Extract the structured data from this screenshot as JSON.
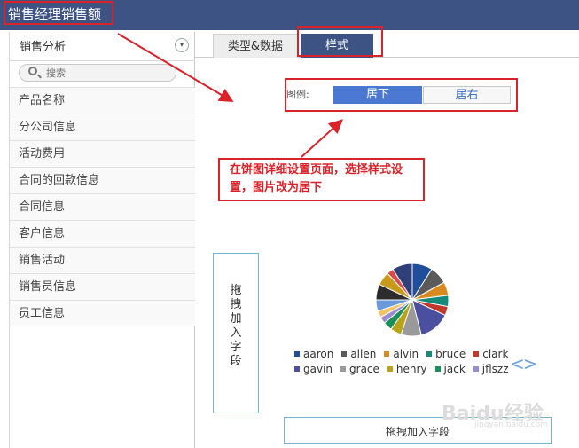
{
  "app": {
    "title": "销售经理销售额"
  },
  "sidebar": {
    "header": "销售分析",
    "search_placeholder": "搜索",
    "items": [
      {
        "label": "产品名称"
      },
      {
        "label": "分公司信息"
      },
      {
        "label": "活动费用"
      },
      {
        "label": "合同的回款信息"
      },
      {
        "label": "合同信息"
      },
      {
        "label": "客户信息"
      },
      {
        "label": "销售活动"
      },
      {
        "label": "销售员信息"
      },
      {
        "label": "员工信息"
      }
    ]
  },
  "tabs": {
    "type_data": "类型&数据",
    "style": "样式"
  },
  "legend_setting": {
    "label": "图例:",
    "options": [
      "居下",
      "居右"
    ],
    "selected": "居下"
  },
  "annotation": {
    "text": "在饼图详细设置页面，选择样式设置，图片改为居下"
  },
  "dropzones": {
    "vertical": "拖拽加入字段",
    "horizontal": "拖拽加入字段"
  },
  "pager": {
    "prev": "<",
    "next": ">"
  },
  "watermark": {
    "brand": "Baidu经验",
    "url": "jingyan.baidu.com"
  },
  "colors": {
    "accent": "#3d5383",
    "highlight": "#d9222a",
    "selected": "#4a78d3"
  },
  "chart_data": {
    "type": "pie",
    "legend_position": "bottom",
    "series": [
      {
        "name": "aaron",
        "color": "#1f4f9a",
        "value": 9
      },
      {
        "name": "allen",
        "color": "#5a5a5a",
        "value": 8
      },
      {
        "name": "alvin",
        "color": "#d98a1f",
        "value": 6
      },
      {
        "name": "bruce",
        "color": "#168a7a",
        "value": 5
      },
      {
        "name": "clark",
        "color": "#c0392b",
        "value": 4
      },
      {
        "name": "gavin",
        "color": "#4a4fa0",
        "value": 14
      },
      {
        "name": "grace",
        "color": "#9a9a9a",
        "value": 9
      },
      {
        "name": "henry",
        "color": "#b8a31a",
        "value": 5
      },
      {
        "name": "jack",
        "color": "#1a8f5a",
        "value": 4
      },
      {
        "name": "jflszz",
        "color": "#9b8ccf",
        "value": 3
      },
      {
        "name": "",
        "color": "#f2c46a",
        "value": 3
      },
      {
        "name": "",
        "color": "#6a9ad9",
        "value": 5
      },
      {
        "name": "",
        "color": "#2c2c2c",
        "value": 7
      },
      {
        "name": "",
        "color": "#c79a1a",
        "value": 6
      },
      {
        "name": "",
        "color": "#d94a4a",
        "value": 3
      },
      {
        "name": "",
        "color": "#2e3f7a",
        "value": 9
      }
    ]
  }
}
